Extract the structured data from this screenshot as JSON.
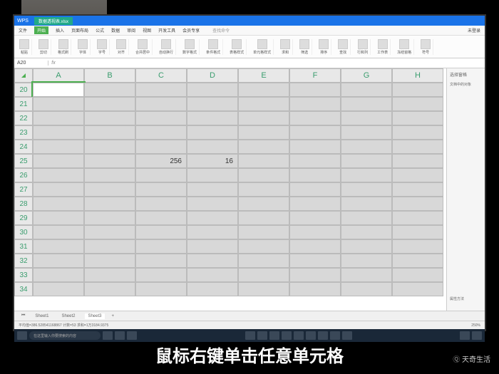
{
  "titlebar": {
    "app_label": "WPS",
    "file_label": "数据透视表.xlsx"
  },
  "menubar": {
    "file": "文件",
    "items": [
      "开始",
      "插入",
      "页面布局",
      "公式",
      "数据",
      "审阅",
      "视图",
      "开发工具",
      "会员专享"
    ],
    "active_index": 0,
    "search_placeholder": "查找命令",
    "login": "未登录"
  },
  "ribbon": [
    {
      "label": "粘贴"
    },
    {
      "label": "剪切"
    },
    {
      "label": "格式刷"
    },
    {
      "label": "字体"
    },
    {
      "label": "字号"
    },
    {
      "label": "对齐"
    },
    {
      "label": "合并居中"
    },
    {
      "label": "自动换行"
    },
    {
      "label": "数字格式"
    },
    {
      "label": "条件格式"
    },
    {
      "label": "表格样式"
    },
    {
      "label": "单元格样式"
    },
    {
      "label": "求和"
    },
    {
      "label": "筛选"
    },
    {
      "label": "排序"
    },
    {
      "label": "查找"
    },
    {
      "label": "行和列"
    },
    {
      "label": "工作表"
    },
    {
      "label": "冻结窗格"
    },
    {
      "label": "符号"
    }
  ],
  "namebox": {
    "ref": "A20",
    "fx": "fx",
    "formula": ""
  },
  "columns": [
    "A",
    "B",
    "C",
    "D",
    "E",
    "F",
    "G",
    "H"
  ],
  "rows": [
    20,
    21,
    22,
    23,
    24,
    25,
    26,
    27,
    28,
    29,
    30,
    31,
    32,
    33,
    34
  ],
  "cells": {
    "C25": "256",
    "D25": "16"
  },
  "sidepanel": {
    "title": "选择窗格",
    "section": "文档中的对象",
    "footer": "属性方法"
  },
  "sheet_tabs": {
    "items": [
      "Sheet1",
      "Sheet2",
      "Sheet3"
    ],
    "active": 2,
    "add": "+"
  },
  "statusbar": {
    "left": "平均值=386.528541168867  计数=53  求和=1万3184.9375",
    "zoom": "250%"
  },
  "taskbar": {
    "search_placeholder": "在这里输入你要搜索的内容"
  },
  "caption": "鼠标右键单击任意单元格",
  "watermark": "天奇生活"
}
